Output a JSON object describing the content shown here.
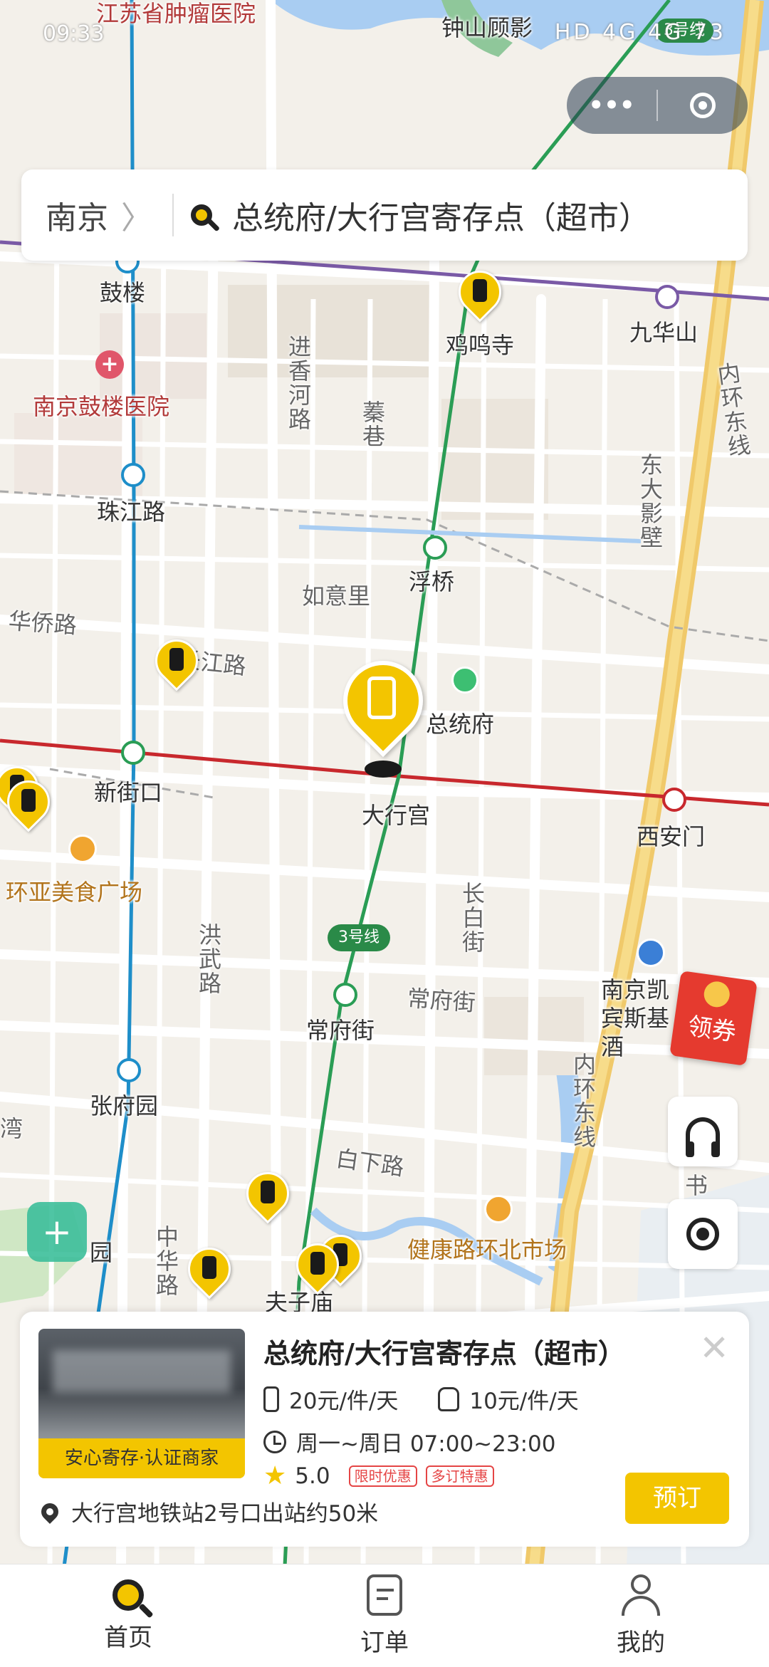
{
  "status_bar": {
    "time": "09:33",
    "icons_text": "HD 4G 4G 73"
  },
  "map": {
    "labels": {
      "hospital_tumor": "江苏省肿瘤医院",
      "zhongshan": "钟山顾影",
      "line3_top": "3号线",
      "gulou": "鼓楼",
      "jimingsi": "鸡鸣寺",
      "jiuhuashan": "九华山",
      "gulou_hospital": "南京鼓楼医院",
      "jinxianghe": "进香河路",
      "qinxiang": "蓁巷",
      "inner_ring_east": "内环东线",
      "dongda": "东大影壁",
      "zhujianglu": "珠江路",
      "fuqiao": "浮桥",
      "ruyili": "如意里",
      "huaqiaolu": "华侨路",
      "changjianglu": "长江路",
      "zongtongfu": "总统府",
      "xinjiekou": "新街口",
      "daxinggong": "大行宫",
      "xianmen": "西安门",
      "huanya": "环亚美食广场",
      "changbaijie": "长白街",
      "hongwulu": "洪武路",
      "line3_badge": "3号线",
      "changfujie_road": "常府街",
      "changfujie_station": "常府街",
      "kempinski": "南京凯宾斯基酒",
      "zhangfuyuan": "张府园",
      "wan": "湾",
      "inner_ring_east2": "内环东线",
      "baixialu": "白下路",
      "shu": "书",
      "yuan": "园",
      "zhonghualu": "中华路",
      "jiankanglu": "健康路环北市场",
      "fuzimiao": "夫子庙"
    }
  },
  "capsule": {
    "more": "•••"
  },
  "search": {
    "city": "南京",
    "chevron": "〉",
    "text": "总统府/大行宫寄存点（超市）"
  },
  "coupon": {
    "label": "领券"
  },
  "shield": {
    "label": "+"
  },
  "card": {
    "title": "总统府/大行宫寄存点（超市）",
    "close": "✕",
    "thumb_tag": "安心寄存·认证商家",
    "price_suitcase": "20元/件/天",
    "price_bag": "10元/件/天",
    "hours": "周一~周日 07:00~23:00",
    "rating": "5.0",
    "star": "★",
    "promo1": "限时优惠",
    "promo2": "多订特惠",
    "address": "大行宫地铁站2号口出站约50米",
    "book": "预订"
  },
  "tabs": [
    {
      "label": "首页",
      "icon": "search-icon"
    },
    {
      "label": "订单",
      "icon": "order-icon"
    },
    {
      "label": "我的",
      "icon": "user-icon"
    }
  ],
  "colors": {
    "accent": "#f3c500",
    "line3": "#2a8a48",
    "line2": "#c8282d",
    "line1": "#1e8ec9"
  }
}
